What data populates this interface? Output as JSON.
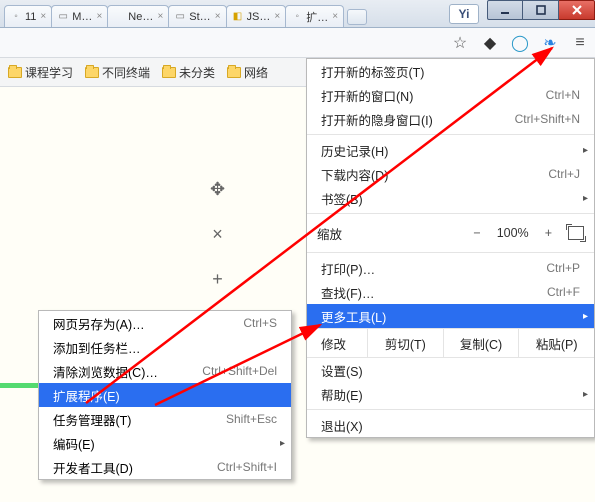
{
  "titlebar": {
    "tabs": [
      {
        "label": "11"
      },
      {
        "label": "M…"
      },
      {
        "label": "New T…"
      },
      {
        "label": "St…"
      },
      {
        "label": "JS…"
      },
      {
        "label": "扩…"
      }
    ],
    "y_button": "Yi"
  },
  "bookmarks": {
    "items": [
      "课程学习",
      "不同终端",
      "未分类",
      "网络"
    ]
  },
  "chrome_menu": {
    "new_tab": {
      "label": "打开新的标签页(T)",
      "shortcut": ""
    },
    "new_window": {
      "label": "打开新的窗口(N)",
      "shortcut": "Ctrl+N"
    },
    "incognito": {
      "label": "打开新的隐身窗口(I)",
      "shortcut": "Ctrl+Shift+N"
    },
    "history": {
      "label": "历史记录(H)",
      "shortcut": ""
    },
    "downloads": {
      "label": "下载内容(D)",
      "shortcut": "Ctrl+J"
    },
    "bookmarks": {
      "label": "书签(B)",
      "shortcut": ""
    },
    "zoom": {
      "label": "缩放",
      "minus": "−",
      "pct": "100%",
      "plus": "+"
    },
    "print": {
      "label": "打印(P)…",
      "shortcut": "Ctrl+P"
    },
    "find": {
      "label": "查找(F)…",
      "shortcut": "Ctrl+F"
    },
    "more_tools": {
      "label": "更多工具(L)",
      "shortcut": ""
    },
    "edit": {
      "label": "修改",
      "cut": "剪切(T)",
      "copy": "复制(C)",
      "paste": "粘贴(P)"
    },
    "settings": {
      "label": "设置(S)"
    },
    "help": {
      "label": "帮助(E)"
    },
    "exit": {
      "label": "退出(X)"
    }
  },
  "sub_menu": {
    "save_as": {
      "label": "网页另存为(A)…",
      "shortcut": "Ctrl+S"
    },
    "add_to_bar": {
      "label": "添加到任务栏…",
      "shortcut": ""
    },
    "clear_data": {
      "label": "清除浏览数据(C)…",
      "shortcut": "Ctrl+Shift+Del"
    },
    "extensions": {
      "label": "扩展程序(E)",
      "shortcut": ""
    },
    "task_mgr": {
      "label": "任务管理器(T)",
      "shortcut": "Shift+Esc"
    },
    "encoding": {
      "label": "编码(E)",
      "shortcut": ""
    },
    "dev_tools": {
      "label": "开发者工具(D)",
      "shortcut": "Ctrl+Shift+I"
    }
  }
}
